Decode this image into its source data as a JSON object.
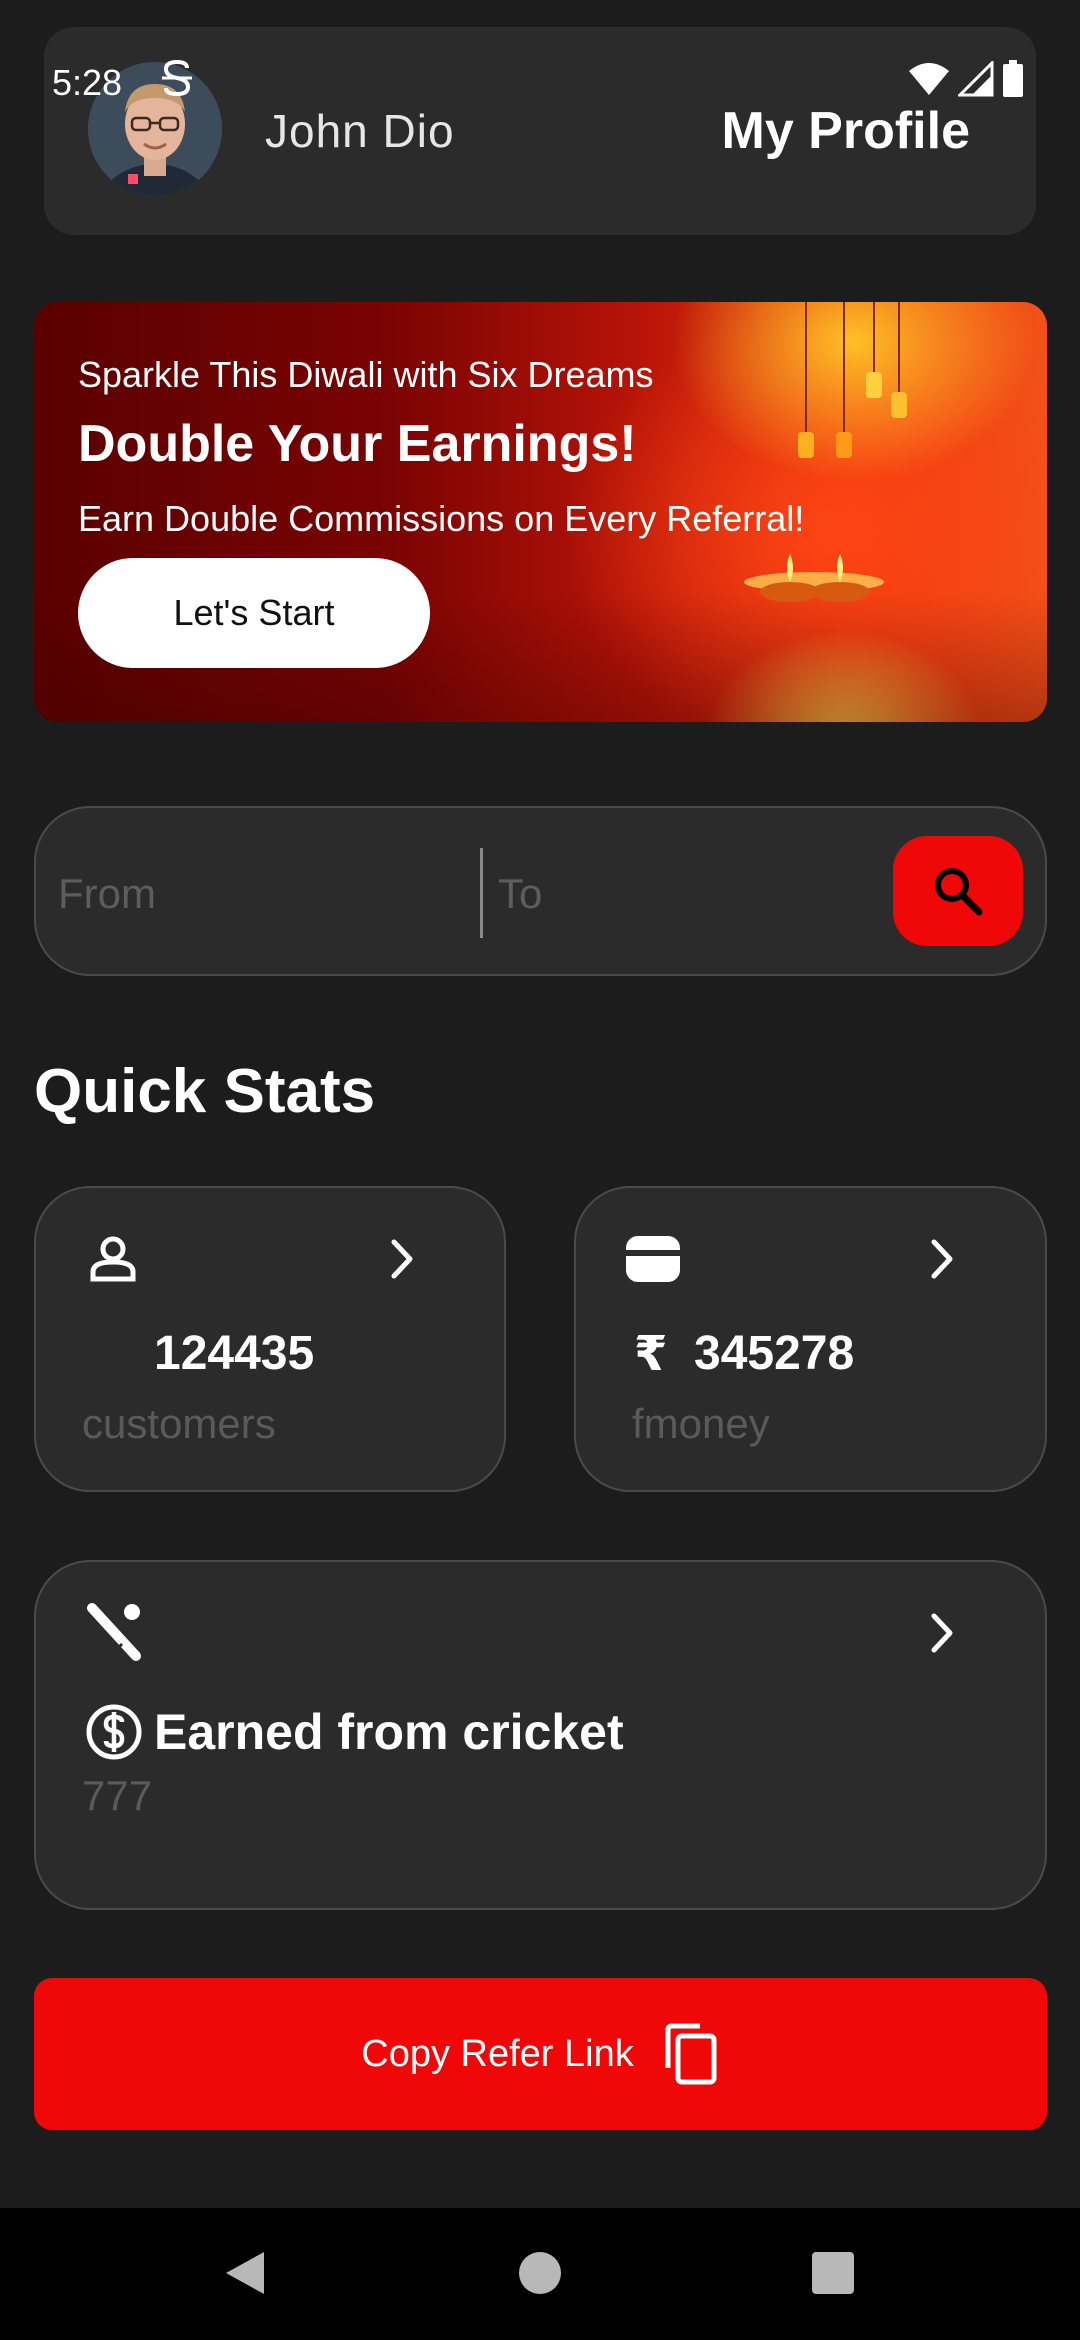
{
  "status_bar": {
    "time": "5:28"
  },
  "header": {
    "user_name": "John Dio",
    "title": "My Profile"
  },
  "banner": {
    "eyebrow": "Sparkle This Diwali with Six Dreams",
    "heading": "Double Your Earnings!",
    "subtext": "Earn Double Commissions on Every Referral!",
    "cta_label": "Let's Start"
  },
  "search": {
    "from_placeholder": "From",
    "to_placeholder": "To"
  },
  "quick_stats": {
    "title": "Quick Stats",
    "customers": {
      "value": "124435",
      "label": "customers",
      "icon": "person-icon"
    },
    "money": {
      "currency": "₹",
      "value": "345278",
      "label": "fmoney",
      "icon": "wallet-icon"
    },
    "cricket": {
      "title": "Earned from cricket",
      "value": "777",
      "icon": "cricket-icon"
    }
  },
  "refer": {
    "label": "Copy Refer Link"
  },
  "colors": {
    "accent": "#f00808",
    "background": "#1c1c1d",
    "card": "#2b2b2c"
  }
}
